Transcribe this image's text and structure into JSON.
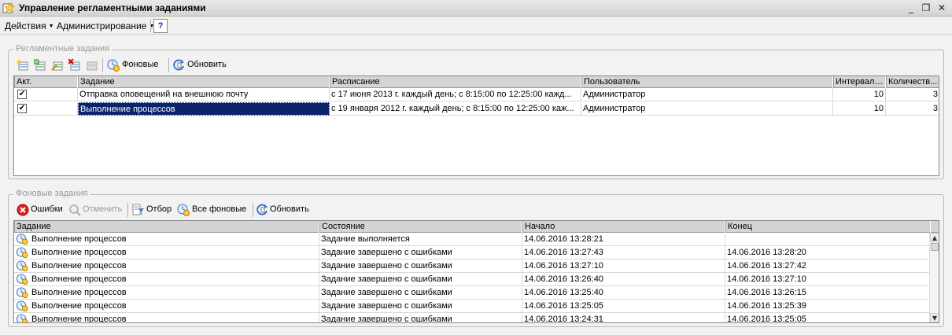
{
  "window": {
    "title": "Управление регламентными заданиями",
    "minimize_glyph": "_",
    "restore_glyph": "❐",
    "close_glyph": "✕"
  },
  "menu": {
    "actions": "Действия",
    "admin": "Администрирование",
    "help": "?"
  },
  "scheduled": {
    "legend": "Регламентные задания",
    "toolbar": {
      "background_label": "Фоновые",
      "refresh_label": "Обновить"
    },
    "columns": [
      "Акт.",
      "Задание",
      "Расписание",
      "Пользователь",
      "Интервал ...",
      "Количеств..."
    ],
    "rows": [
      {
        "active": true,
        "task": "Отправка оповещений на внешнюю почту",
        "schedule": "с 17 июня 2013 г. каждый  день; с 8:15:00 по 12:25:00 кажд...",
        "user": "Администратор",
        "interval": "10",
        "count": "3",
        "selected": false
      },
      {
        "active": true,
        "task": "Выполнение процессов",
        "schedule": "с 19 января 2012 г. каждый  день; с 8:15:00 по 12:25:00 каж...",
        "user": "Администратор",
        "interval": "10",
        "count": "3",
        "selected": true
      }
    ]
  },
  "background": {
    "legend": "Фоновые задания",
    "toolbar": {
      "errors_label": "Ошибки",
      "cancel_label": "Отменить",
      "filter_label": "Отбор",
      "all_label": "Все фоновые",
      "refresh_label": "Обновить"
    },
    "columns": [
      "Задание",
      "Состояние",
      "Начало",
      "Конец"
    ],
    "rows": [
      {
        "task": "Выполнение процессов",
        "state": "Задание выполняется",
        "start": "14.06.2016 13:28:21",
        "end": ""
      },
      {
        "task": "Выполнение процессов",
        "state": "Задание завершено с ошибками",
        "start": "14.06.2016 13:27:43",
        "end": "14.06.2016 13:28:20"
      },
      {
        "task": "Выполнение процессов",
        "state": "Задание завершено с ошибками",
        "start": "14.06.2016 13:27:10",
        "end": "14.06.2016 13:27:42"
      },
      {
        "task": "Выполнение процессов",
        "state": "Задание завершено с ошибками",
        "start": "14.06.2016 13:26:40",
        "end": "14.06.2016 13:27:10"
      },
      {
        "task": "Выполнение процессов",
        "state": "Задание завершено с ошибками",
        "start": "14.06.2016 13:25:40",
        "end": "14.06.2016 13:26:15"
      },
      {
        "task": "Выполнение процессов",
        "state": "Задание завершено с ошибками",
        "start": "14.06.2016 13:25:05",
        "end": "14.06.2016 13:25:39"
      },
      {
        "task": "Выполнение процессов",
        "state": "Задание завершено с ошибками",
        "start": "14.06.2016 13:24:31",
        "end": "14.06.2016 13:25:05"
      }
    ],
    "scroll_up_glyph": "▲",
    "scroll_down_glyph": "▼"
  },
  "colors": {
    "selection": "#0a246a",
    "header": "#d4d4d4",
    "window_bg": "#f2f2f2"
  }
}
